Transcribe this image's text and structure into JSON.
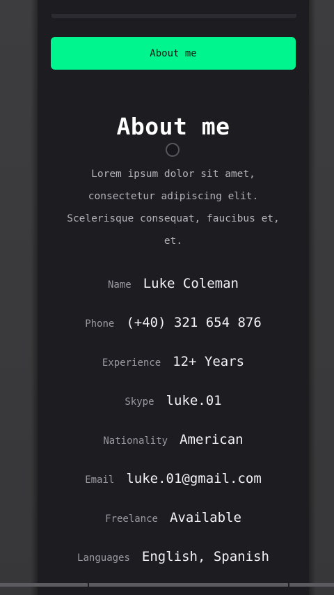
{
  "header": {
    "button_label": "About me"
  },
  "about": {
    "title": "About me",
    "intro_lines": [
      "Lorem ipsum dolor sit amet,",
      "consectetur adipiscing elit.",
      "Scelerisque consequat, faucibus et,",
      "et."
    ]
  },
  "info": [
    {
      "label": "Name",
      "value": "Luke Coleman"
    },
    {
      "label": "Phone",
      "value": "(+40) 321 654 876"
    },
    {
      "label": "Experience",
      "value": "12+ Years"
    },
    {
      "label": "Skype",
      "value": "luke.01"
    },
    {
      "label": "Nationality",
      "value": "American"
    },
    {
      "label": "Email",
      "value": "luke.01@gmail.com"
    },
    {
      "label": "Freelance",
      "value": "Available"
    },
    {
      "label": "Languages",
      "value": "English, Spanish"
    }
  ],
  "colors": {
    "accent": "#00f58f",
    "panel_background": "#1c1c21",
    "page_background": "#3a3a3c",
    "label_text": "#9a9aa2",
    "value_text": "#f2f2f5"
  },
  "icons": {
    "cursor": "circle-cursor-icon"
  }
}
